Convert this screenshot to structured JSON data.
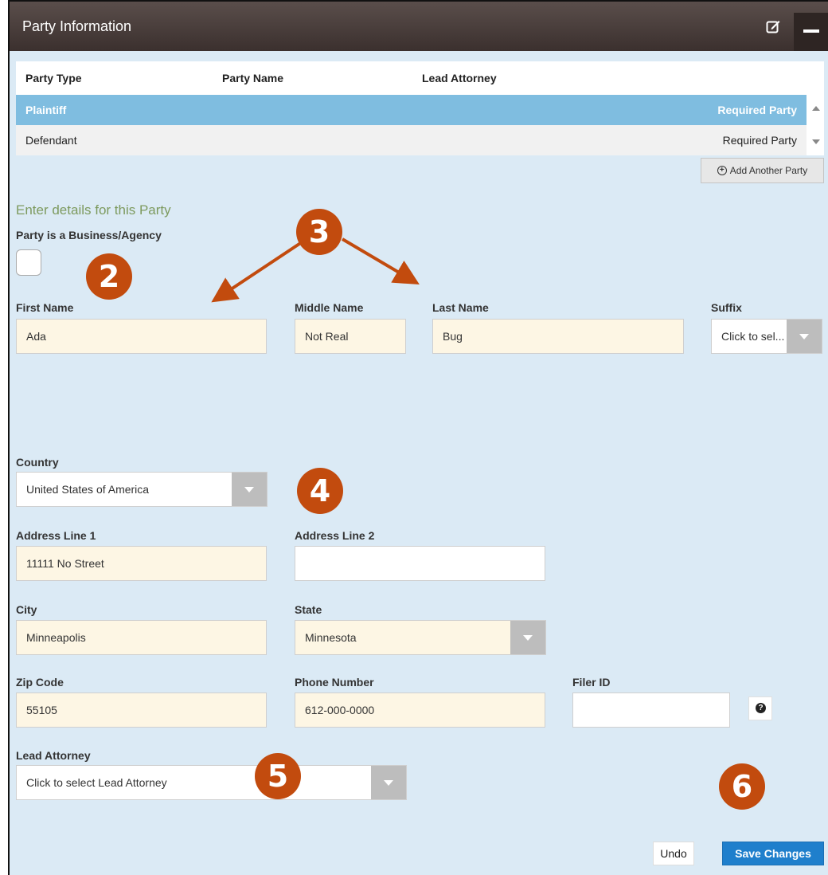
{
  "panel": {
    "title": "Party Information"
  },
  "party_table": {
    "columns": [
      "Party Type",
      "Party Name",
      "Lead Attorney"
    ],
    "rows": [
      {
        "party_type": "Plaintiff",
        "status": "Required Party",
        "selected": true
      },
      {
        "party_type": "Defendant",
        "status": "Required Party",
        "selected": false
      }
    ],
    "add_button_label": "Add Another Party"
  },
  "details": {
    "heading": "Enter details for this Party",
    "business_label": "Party is a Business/Agency",
    "first_name_label": "First Name",
    "first_name_value": "Ada",
    "middle_name_label": "Middle Name",
    "middle_name_value": "Not Real",
    "last_name_label": "Last Name",
    "last_name_value": "Bug",
    "suffix_label": "Suffix",
    "suffix_value": "Click to sel...",
    "country_label": "Country",
    "country_value": "United States of America",
    "address1_label": "Address Line 1",
    "address1_value": "11111 No Street",
    "address2_label": "Address Line 2",
    "address2_value": "",
    "city_label": "City",
    "city_value": "Minneapolis",
    "state_label": "State",
    "state_value": "Minnesota",
    "zip_label": "Zip Code",
    "zip_value": "55105",
    "phone_label": "Phone Number",
    "phone_value": "612-000-0000",
    "filer_label": "Filer ID",
    "filer_value": "",
    "lead_attorney_label": "Lead Attorney",
    "lead_attorney_value": "Click to select Lead Attorney"
  },
  "buttons": {
    "undo": "Undo",
    "save": "Save Changes"
  },
  "callouts": [
    "2",
    "3",
    "4",
    "5",
    "6"
  ],
  "colors": {
    "title_bar": "#3b302e",
    "panel_bg": "#dbeaf5",
    "selected_row": "#7fbde0",
    "filled_field": "#fdf6e4",
    "callout": "#c24b0e",
    "save_button": "#1f7fcc",
    "section_heading": "#7d9a5e"
  },
  "icons": {
    "edit": "edit-icon",
    "minimize": "minimize-icon",
    "add": "plus-circle-icon",
    "help": "question-circle-icon",
    "dropdown": "chevron-down-icon"
  }
}
